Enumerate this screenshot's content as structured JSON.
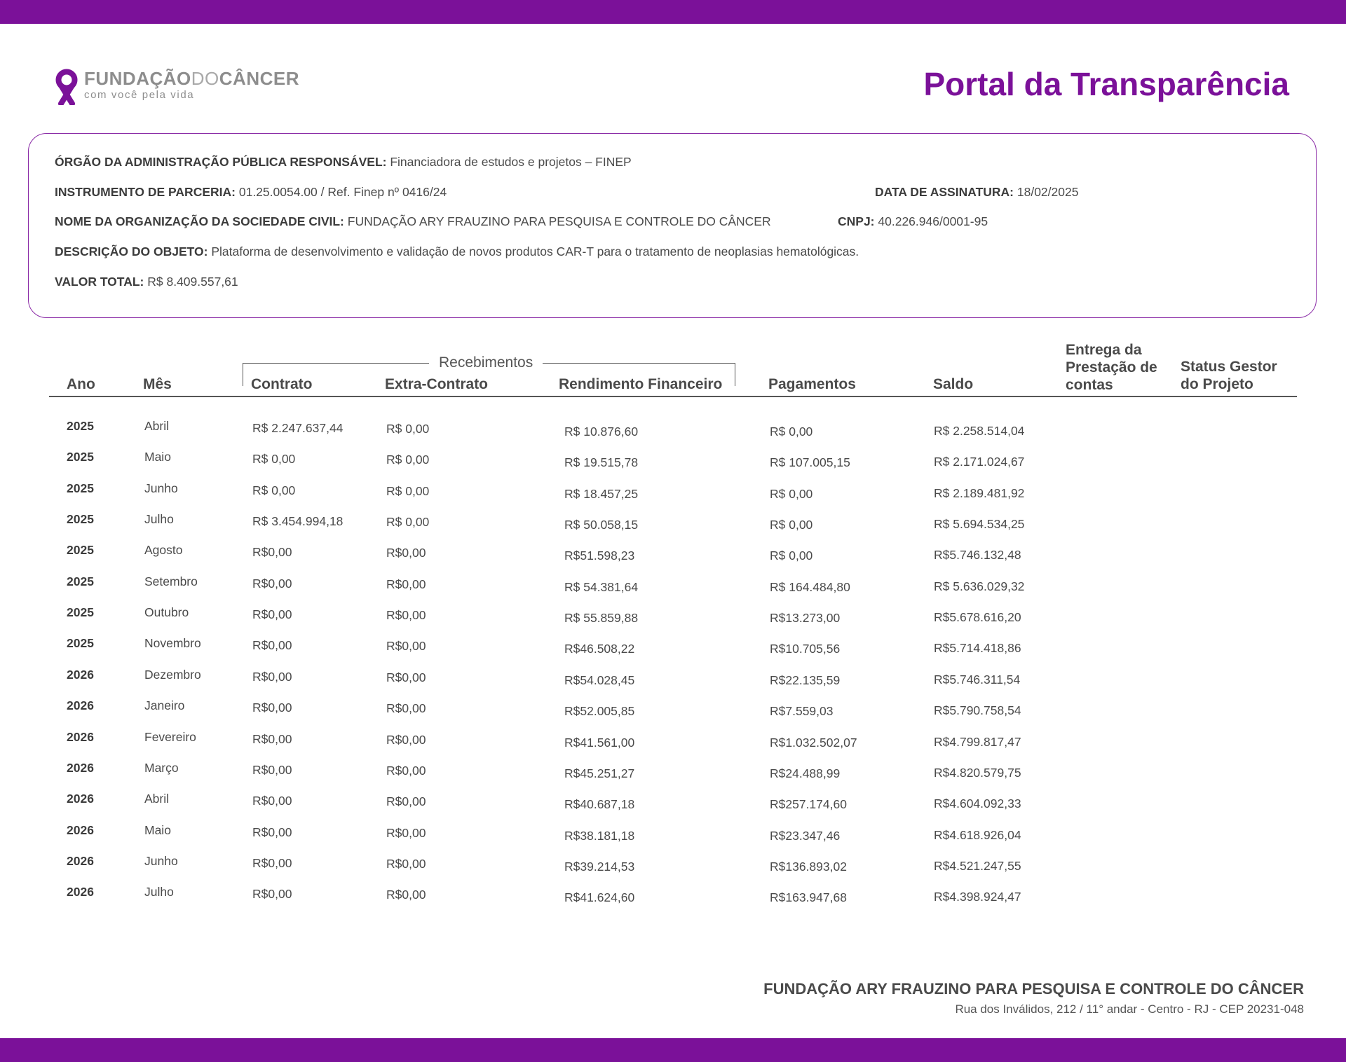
{
  "brand": {
    "logo_word1": "FUNDAÇÃO",
    "logo_word2": "DO",
    "logo_word3": "CÂNCER",
    "tagline": "com você  pela vida",
    "accent_color": "#7b1199"
  },
  "page_title": "Portal da Transparência",
  "info": {
    "orgao_label": "ÓRGÃO DA ADMINISTRAÇÃO PÚBLICA RESPONSÁVEL:",
    "orgao_value": "Financiadora de estudos e projetos – FINEP",
    "instrumento_label": "INSTRUMENTO DE PARCERIA:",
    "instrumento_value": "01.25.0054.00 / Ref. Finep nº 0416/24",
    "data_label": "DATA DE ASSINATURA:",
    "data_value": "18/02/2025",
    "organizacao_label": "NOME DA ORGANIZAÇÃO DA SOCIEDADE CIVIL:",
    "organizacao_value": "FUNDAÇÃO ARY FRAUZINO PARA PESQUISA E CONTROLE DO CÂNCER",
    "cnpj_label": "CNPJ:",
    "cnpj_value": "40.226.946/0001-95",
    "descricao_label": "DESCRIÇÃO DO OBJETO:",
    "descricao_value": "Plataforma de desenvolvimento e validação de novos produtos CAR-T para o tratamento de neoplasias hematológicas.",
    "valor_label": "VALOR TOTAL:",
    "valor_value": "R$ 8.409.557,61"
  },
  "table": {
    "group_label": "Recebimentos",
    "headers": {
      "ano": "Ano",
      "mes": "Mês",
      "contrato": "Contrato",
      "extra": "Extra-Contrato",
      "rendimento": "Rendimento Financeiro",
      "pagamentos": "Pagamentos",
      "saldo": "Saldo",
      "entrega": "Entrega da Prestação de contas",
      "status": "Status Gestor do Projeto"
    },
    "rows": [
      {
        "ano": "2025",
        "mes": "Abril",
        "contrato": "R$ 2.247.637,44",
        "extra": "R$ 0,00",
        "rendimento": "R$ 10.876,60",
        "pagamentos": "R$ 0,00",
        "saldo": "R$ 2.258.514,04"
      },
      {
        "ano": "2025",
        "mes": "Maio",
        "contrato": "R$ 0,00",
        "extra": "R$ 0,00",
        "rendimento": "R$ 19.515,78",
        "pagamentos": "R$ 107.005,15",
        "saldo": "R$ 2.171.024,67"
      },
      {
        "ano": "2025",
        "mes": "Junho",
        "contrato": "R$ 0,00",
        "extra": "R$ 0,00",
        "rendimento": "R$ 18.457,25",
        "pagamentos": "R$ 0,00",
        "saldo": "R$ 2.189.481,92"
      },
      {
        "ano": "2025",
        "mes": "Julho",
        "contrato": "R$ 3.454.994,18",
        "extra": "R$ 0,00",
        "rendimento": "R$ 50.058,15",
        "pagamentos": "R$ 0,00",
        "saldo": "R$ 5.694.534,25"
      },
      {
        "ano": "2025",
        "mes": "Agosto",
        "contrato": "R$0,00",
        "extra": "R$0,00",
        "rendimento": "R$51.598,23",
        "pagamentos": "R$ 0,00",
        "saldo": "R$5.746.132,48"
      },
      {
        "ano": "2025",
        "mes": "Setembro",
        "contrato": "R$0,00",
        "extra": "R$0,00",
        "rendimento": "R$ 54.381,64",
        "pagamentos": "R$ 164.484,80",
        "saldo": "R$ 5.636.029,32"
      },
      {
        "ano": "2025",
        "mes": "Outubro",
        "contrato": "R$0,00",
        "extra": "R$0,00",
        "rendimento": "R$ 55.859,88",
        "pagamentos": "R$13.273,00",
        "saldo": "R$5.678.616,20"
      },
      {
        "ano": "2025",
        "mes": "Novembro",
        "contrato": "R$0,00",
        "extra": "R$0,00",
        "rendimento": "R$46.508,22",
        "pagamentos": "R$10.705,56",
        "saldo": "R$5.714.418,86"
      },
      {
        "ano": "2026",
        "mes": "Dezembro",
        "contrato": "R$0,00",
        "extra": "R$0,00",
        "rendimento": "R$54.028,45",
        "pagamentos": "R$22.135,59",
        "saldo": "R$5.746.311,54"
      },
      {
        "ano": "2026",
        "mes": "Janeiro",
        "contrato": "R$0,00",
        "extra": "R$0,00",
        "rendimento": "R$52.005,85",
        "pagamentos": "R$7.559,03",
        "saldo": "R$5.790.758,54"
      },
      {
        "ano": "2026",
        "mes": "Fevereiro",
        "contrato": "R$0,00",
        "extra": "R$0,00",
        "rendimento": "R$41.561,00",
        "pagamentos": "R$1.032.502,07",
        "saldo": "R$4.799.817,47"
      },
      {
        "ano": "2026",
        "mes": "Março",
        "contrato": "R$0,00",
        "extra": "R$0,00",
        "rendimento": "R$45.251,27",
        "pagamentos": "R$24.488,99",
        "saldo": "R$4.820.579,75"
      },
      {
        "ano": "2026",
        "mes": "Abril",
        "contrato": "R$0,00",
        "extra": "R$0,00",
        "rendimento": "R$40.687,18",
        "pagamentos": "R$257.174,60",
        "saldo": "R$4.604.092,33"
      },
      {
        "ano": "2026",
        "mes": "Maio",
        "contrato": "R$0,00",
        "extra": "R$0,00",
        "rendimento": "R$38.181,18",
        "pagamentos": "R$23.347,46",
        "saldo": "R$4.618.926,04"
      },
      {
        "ano": "2026",
        "mes": "Junho",
        "contrato": "R$0,00",
        "extra": "R$0,00",
        "rendimento": "R$39.214,53",
        "pagamentos": "R$136.893,02",
        "saldo": "R$4.521.247,55"
      },
      {
        "ano": "2026",
        "mes": "Julho",
        "contrato": "R$0,00",
        "extra": "R$0,00",
        "rendimento": "R$41.624,60",
        "pagamentos": "R$163.947,68",
        "saldo": "R$4.398.924,47"
      }
    ]
  },
  "footer": {
    "org_name": "FUNDAÇÃO ARY FRAUZINO PARA PESQUISA E CONTROLE DO CÂNCER",
    "address": "Rua dos Inválidos, 212 / 11° andar - Centro - RJ - CEP 20231-048"
  }
}
